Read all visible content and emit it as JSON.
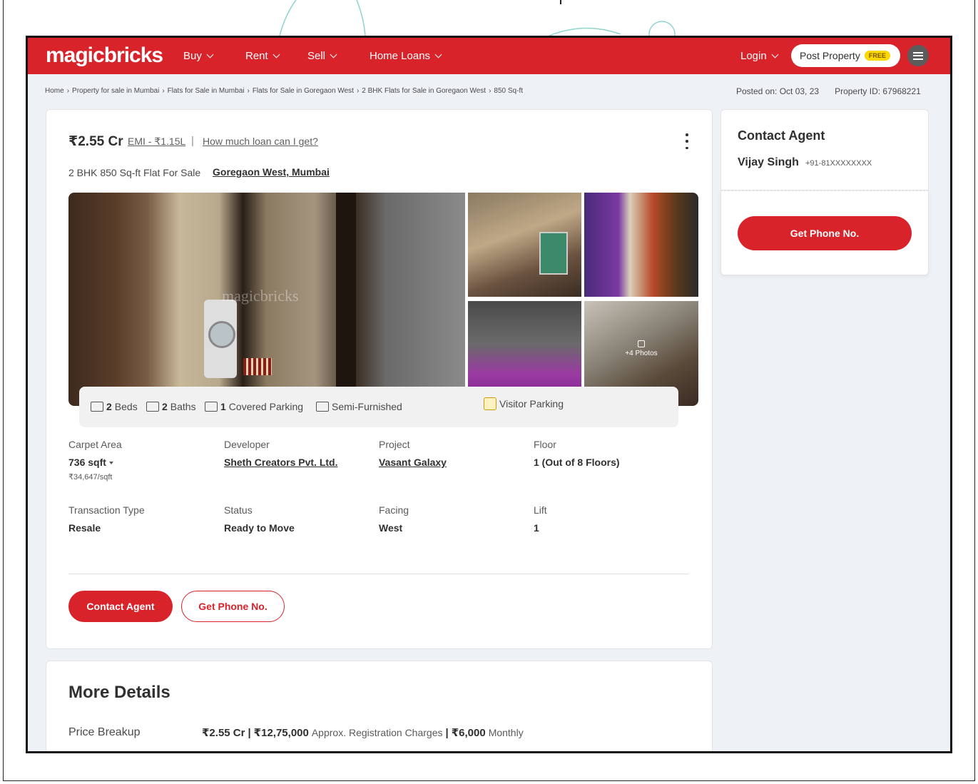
{
  "colors": {
    "brand": "#d8232a",
    "free_badge": "#fdd700",
    "page_bg": "#eef2f6"
  },
  "navbar": {
    "logo": "magicbricks",
    "items": [
      {
        "label": "Buy"
      },
      {
        "label": "Rent"
      },
      {
        "label": "Sell"
      },
      {
        "label": "Home Loans"
      }
    ],
    "login": "Login",
    "post_property": "Post Property",
    "free_badge": "FREE",
    "menu_icon": "hamburger-icon"
  },
  "breadcrumb": [
    "Home",
    "Property for sale in Mumbai",
    "Flats for Sale in Mumbai",
    "Flats for Sale in Goregaon West",
    "2 BHK Flats for Sale in Goregaon West",
    "850 Sq-ft"
  ],
  "meta": {
    "posted_on": "Posted on: Oct 03, 23",
    "property_id": "Property ID: 67968221"
  },
  "listing": {
    "price": "₹2.55 Cr",
    "emi": "EMI - ₹1.15L",
    "separator": "|",
    "loan_link": "How much loan can I get?",
    "subtitle": "2 BHK 850 Sq-ft Flat For Sale",
    "locality": "Goregaon West, Mumbai",
    "watermark": "magicbricks",
    "more_photos": "+4 Photos"
  },
  "amenities": {
    "beds_count": "2",
    "beds_label": "Beds",
    "baths_count": "2",
    "baths_label": "Baths",
    "parking_count": "1",
    "parking_label": "Covered Parking",
    "furnishing": "Semi-Furnished",
    "visitor_parking": "Visitor Parking"
  },
  "details": [
    {
      "label": "Carpet Area",
      "value": "736 sqft",
      "sub": "₹34,647/sqft"
    },
    {
      "label": "Developer",
      "value": "Sheth Creators Pvt. Ltd."
    },
    {
      "label": "Project",
      "value": "Vasant Galaxy"
    },
    {
      "label": "Floor",
      "value": "1 (Out of 8 Floors)"
    },
    {
      "label": "Transaction Type",
      "value": "Resale"
    },
    {
      "label": "Status",
      "value": "Ready to Move"
    },
    {
      "label": "Facing",
      "value": "West"
    },
    {
      "label": "Lift",
      "value": "1"
    }
  ],
  "actions": {
    "contact_agent": "Contact Agent",
    "get_phone": "Get Phone No."
  },
  "more_details": {
    "title": "More Details",
    "price_breakup_label": "Price Breakup",
    "price": "₹2.55 Cr",
    "registration": "₹12,75,000",
    "registration_label": "Approx. Registration Charges",
    "maintenance": "₹6,000",
    "maintenance_label": "Monthly"
  },
  "sidebar": {
    "title": "Contact Agent",
    "agent_name": "Vijay Singh",
    "agent_phone": "+91-81XXXXXXXX",
    "get_phone": "Get Phone No."
  }
}
